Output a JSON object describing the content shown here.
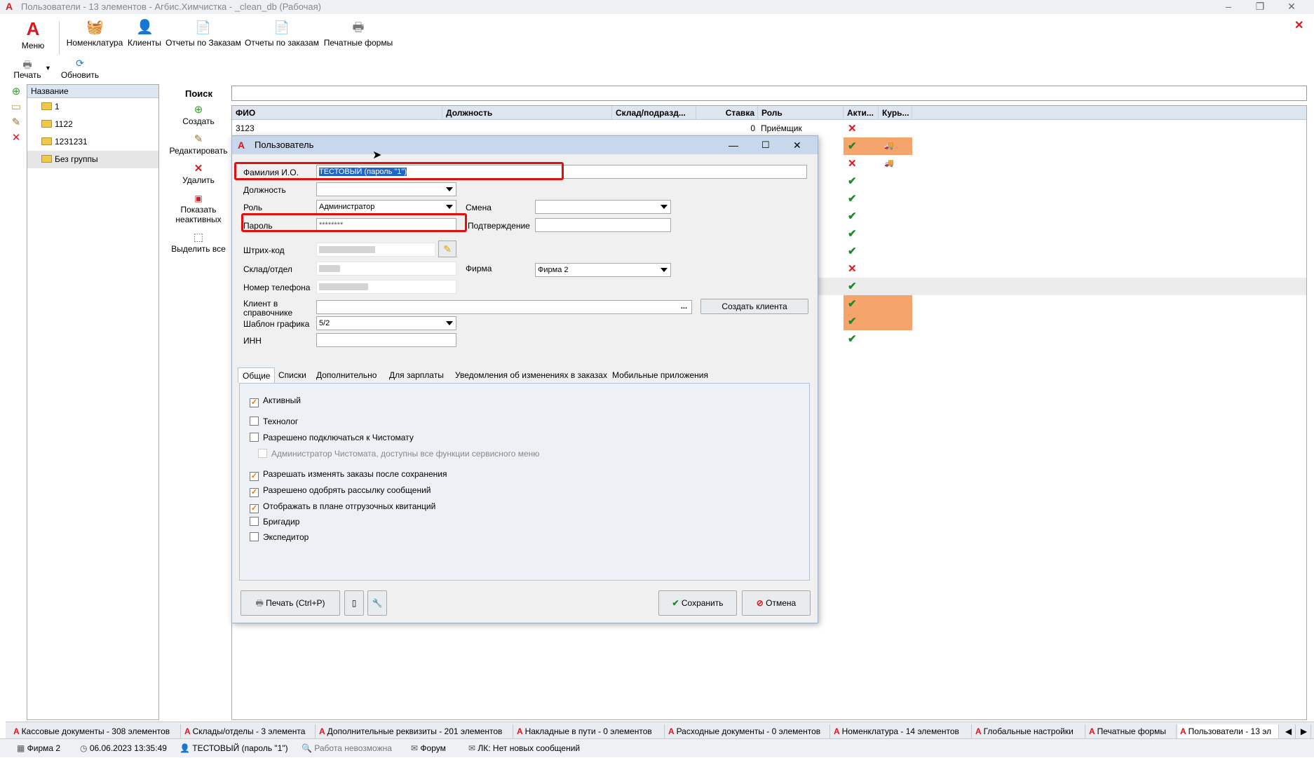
{
  "window": {
    "title": "Пользователи - 13 элементов - Агбис.Химчистка - _clean_db (Рабочая)"
  },
  "ribbon": {
    "menu": "Меню",
    "items": [
      "Номенклатура",
      "Клиенты",
      "Отчеты по Заказам",
      "Отчеты по заказам",
      "Печатные формы"
    ],
    "print": "Печать",
    "refresh": "Обновить"
  },
  "tree": {
    "header": "Название",
    "items": [
      "1",
      "1122",
      "1231231",
      "Без группы"
    ]
  },
  "actions": {
    "create": "Создать",
    "edit": "Редактировать",
    "delete": "Удалить",
    "show_inactive": "Показать неактивных",
    "select_all": "Выделить все"
  },
  "search": {
    "label": "Поиск",
    "value": ""
  },
  "grid": {
    "columns": [
      "ФИО",
      "Должность",
      "Склад/подразд...",
      "Ставка",
      "Роль",
      "Акти...",
      "Курь..."
    ],
    "first_row": {
      "fio": "3123",
      "rate": "0",
      "role": "Приёмщик"
    }
  },
  "dialog": {
    "title": "Пользователь",
    "fio_label": "Фамилия И.О.",
    "fio_value": "ТЕСТОВЫЙ (пароль \"1\")",
    "position_label": "Должность",
    "position_value": "",
    "role_label": "Роль",
    "role_value": "Администратор",
    "shift_label": "Смена",
    "shift_value": "",
    "password_label": "Пароль",
    "password_value": "********",
    "confirm_label": "Подтверждение",
    "confirm_value": "",
    "barcode_label": "Штрих-код",
    "warehouse_label": "Склад/отдел",
    "firm_label": "Фирма",
    "firm_value": "Фирма 2",
    "phone_label": "Номер телефона",
    "client_label": "Клиент в справочнике",
    "client_btn": "...",
    "create_client": "Создать клиента",
    "schedule_label": "Шаблон графика",
    "schedule_value": "5/2",
    "inn_label": "ИНН",
    "inn_value": "",
    "tabs": [
      "Общие",
      "Списки",
      "Дополнительно",
      "Для зарплаты",
      "Уведомления об изменениях в заказах",
      "Мобильные приложения"
    ],
    "checkboxes": [
      {
        "label": "Активный",
        "checked": true
      },
      {
        "label": "Технолог",
        "checked": false
      },
      {
        "label": "Разрешено подключаться к Чистомату",
        "checked": false
      },
      {
        "label": "Администратор Чистомата, доступны все функции сервисного меню",
        "checked": false
      },
      {
        "label": "Разрешать изменять заказы после сохранения",
        "checked": true
      },
      {
        "label": "Разрешено одобрять рассылку сообщений",
        "checked": true
      },
      {
        "label": "Отображать в плане отгрузочных квитанций",
        "checked": true
      },
      {
        "label": "Бригадир",
        "checked": false
      },
      {
        "label": "Экспедитор",
        "checked": false
      }
    ],
    "print_btn": "Печать (Ctrl+P)",
    "save_btn": "Сохранить",
    "cancel_btn": "Отмена"
  },
  "doc_tabs": [
    "Кассовые документы - 308 элементов",
    "Склады/отделы - 3 элемента",
    "Дополнительные реквизиты - 201 элементов",
    "Накладные в пути - 0 элементов",
    "Расходные документы - 0 элементов",
    "Номенклатура - 14 элементов",
    "Глобальные настройки",
    "Печатные формы",
    "Пользователи - 13 эл"
  ],
  "status": {
    "firm": "Фирма 2",
    "datetime": "06.06.2023 13:35:49",
    "user": "ТЕСТОВЫЙ (пароль \"1\")",
    "work": "Работа невозможна",
    "forum": "Форум",
    "lk": "ЛК: Нет новых сообщений"
  }
}
